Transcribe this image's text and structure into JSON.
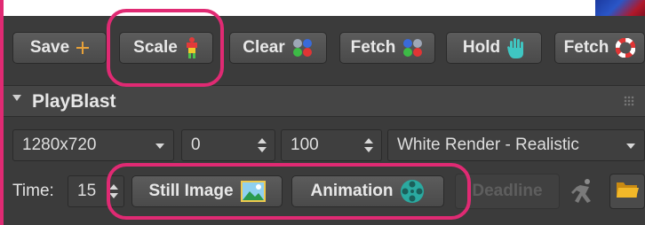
{
  "toolbar": {
    "save_label": "Save",
    "scale_label": "Scale",
    "clear_label": "Clear",
    "fetch_label": "Fetch",
    "hold_label": "Hold",
    "fetch2_label": "Fetch"
  },
  "section": {
    "title": "PlayBlast"
  },
  "playblast": {
    "resolution": "1280x720",
    "start_frame": "0",
    "end_frame": "100",
    "render_mode": "White Render - Realistic"
  },
  "time": {
    "label": "Time:",
    "value": "15"
  },
  "buttons": {
    "still_image_label": "Still Image",
    "animation_label": "Animation",
    "deadline_label": "Deadline"
  },
  "colors": {
    "accent_highlight": "#e02a73",
    "panel_bg": "#3b3b3b",
    "save_plus": "#e7a13a",
    "hold_hand": "#3fc6c2"
  },
  "icons": [
    "plus-icon",
    "scale-figure-icon",
    "rgb-dots-icon",
    "hand-icon",
    "lifebuoy-icon",
    "image-icon",
    "film-reel-icon",
    "runner-icon",
    "folder-icon"
  ]
}
